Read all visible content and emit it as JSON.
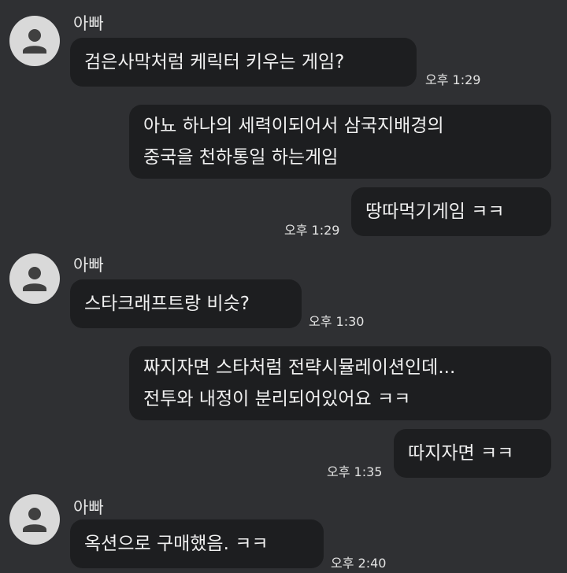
{
  "contact": {
    "name": "아빠"
  },
  "messages": [
    {
      "lines": [
        "검은사막처럼 케릭터 키우는 게임?"
      ],
      "time": "오후 1:29"
    },
    {
      "lines": [
        "아뇨 하나의 세력이되어서 삼국지배경의",
        "중국을 천하통일 하는게임"
      ]
    },
    {
      "lines": [
        "땅따먹기게임 ㅋㅋ"
      ],
      "time": "오후 1:29"
    },
    {
      "lines": [
        "스타크래프트랑 비슷?"
      ],
      "time": "오후 1:30"
    },
    {
      "lines": [
        "짜지자면 스타처럼 전략시뮬레이션인데...",
        "전투와 내정이 분리되어있어요 ㅋㅋ"
      ]
    },
    {
      "lines": [
        "따지자면 ㅋㅋ"
      ],
      "time": "오후 1:35"
    },
    {
      "lines": [
        "옥션으로 구매했음. ㅋㅋ"
      ],
      "time": "오후 2:40"
    }
  ]
}
